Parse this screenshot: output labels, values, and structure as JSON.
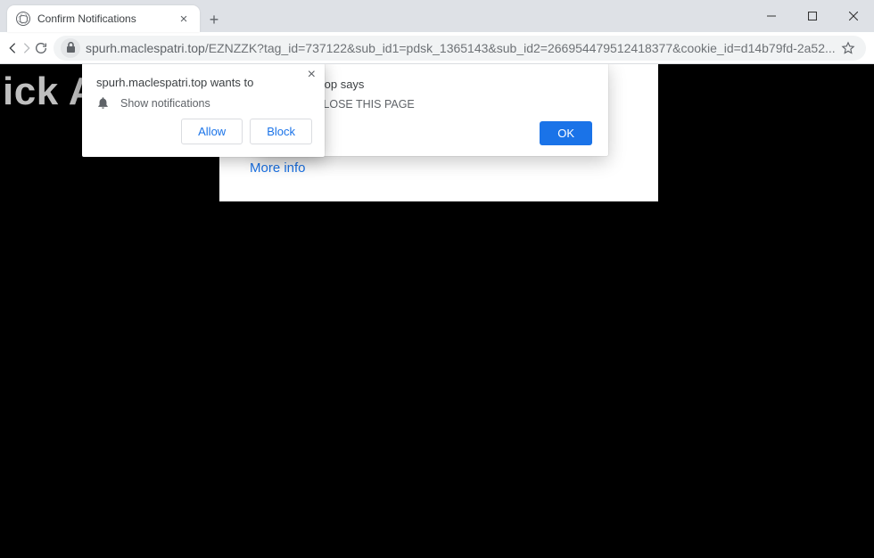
{
  "window": {
    "tab_title": "Confirm Notifications"
  },
  "toolbar": {
    "url_host": "spurh.maclespatri.top",
    "url_path": "/EZNZZK?tag_id=737122&sub_id1=pdsk_1365143&sub_id2=266954479512418377&cookie_id=d14b79fd-2a52..."
  },
  "page": {
    "background_text": "Click Allow to confirm you are not a",
    "more_info": "More info",
    "alert": {
      "title_suffix": "clespatri.top says",
      "body_suffix": "OW TO CLOSE THIS PAGE",
      "ok": "OK"
    },
    "permission": {
      "title": "spurh.maclespatri.top wants to",
      "row_text": "Show notifications",
      "allow": "Allow",
      "block": "Block"
    }
  }
}
